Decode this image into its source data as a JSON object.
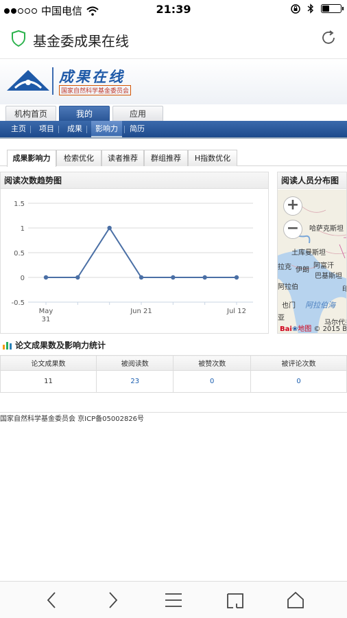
{
  "status": {
    "carrier": "中国电信",
    "time": "21:39",
    "battery_level": 0.35
  },
  "browser": {
    "page_title": "基金委成果在线",
    "secure_icon": "shield-check-icon",
    "reload_icon": "reload-icon"
  },
  "banner": {
    "logo_title": "成果在线",
    "logo_subtitle": "国家自然科学基金委员会"
  },
  "main_tabs": [
    {
      "label": "机构首页",
      "active": false
    },
    {
      "label": "我的",
      "active": true
    },
    {
      "label": "应用",
      "active": false
    }
  ],
  "sub_nav": [
    {
      "label": "主页",
      "active": false
    },
    {
      "label": "项目",
      "active": false
    },
    {
      "label": "成果",
      "active": false
    },
    {
      "label": "影响力",
      "active": true
    },
    {
      "label": "简历",
      "active": false
    }
  ],
  "secondary_tabs": [
    {
      "label": "成果影响力",
      "active": true
    },
    {
      "label": "检索优化",
      "active": false
    },
    {
      "label": "读者推荐",
      "active": false
    },
    {
      "label": "群组推荐",
      "active": false
    },
    {
      "label": "H指数优化",
      "active": false
    }
  ],
  "trend_panel": {
    "title": "阅读次数趋势图"
  },
  "chart_data": {
    "type": "line",
    "title": "",
    "xlabel": "",
    "ylabel": "",
    "x": [
      "May 31",
      "Jun 7",
      "Jun 14",
      "Jun 21",
      "Jun 28",
      "Jul 5",
      "Jul 12"
    ],
    "x_tick_labels": [
      "May 31",
      "Jun 21",
      "Jul 12"
    ],
    "series": [
      {
        "values": [
          0,
          0,
          1,
          0,
          0,
          0,
          0
        ]
      }
    ],
    "y_ticks": [
      "1.5",
      "1",
      "0.5",
      "0",
      "-0.5"
    ],
    "ylim": [
      -0.5,
      1.5
    ],
    "grid": true,
    "color": "#4a6fa5"
  },
  "reader_panel": {
    "title": "阅读人员分布图",
    "zoom_in": "+",
    "zoom_out": "−",
    "map_labels": {
      "kazakhstan": "哈萨克斯坦",
      "turkmenistan": "土库曼斯坦",
      "iraq": "拉克",
      "iran": "伊朗",
      "afghanistan": "阿富汗",
      "pakistan": "巴基斯坦",
      "arabia": "阿拉伯",
      "india": "印",
      "arabian_sea": "阿拉伯海",
      "oman": "也门",
      "maldives": "马尔代夫",
      "asia": "亚"
    },
    "attribution_brand": "Bai",
    "attribution_map": "地图",
    "attribution_copyright": "© 2015 Bai"
  },
  "stats": {
    "title": "论文成果数及影响力统计",
    "headers": [
      "论文成果数",
      "被阅读数",
      "被赞次数",
      "被评论次数"
    ],
    "values": [
      "11",
      "23",
      "0",
      "0"
    ]
  },
  "footer": {
    "text": "国家自然科学基金委员会 京ICP备05002826号"
  },
  "toolbar": {
    "back_icon": "chevron-left-icon",
    "forward_icon": "chevron-right-icon",
    "menu_icon": "menu-icon",
    "tabs_icon": "tabs-icon",
    "home_icon": "home-icon"
  }
}
